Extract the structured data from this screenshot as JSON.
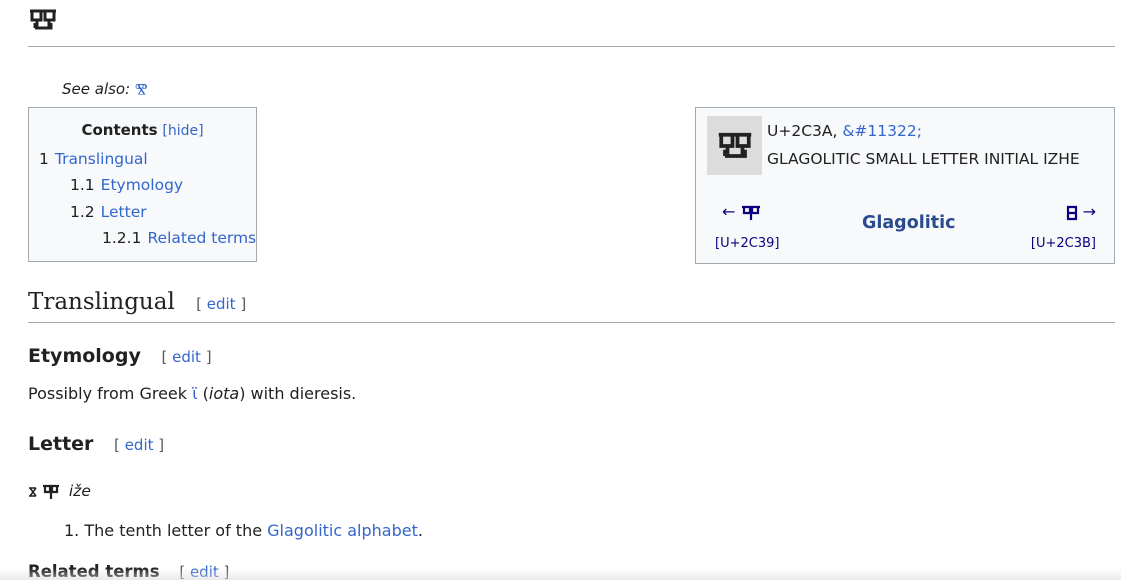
{
  "see_also": {
    "label": "See also:",
    "glyph": "Ⰺ"
  },
  "toc": {
    "title": "Contents",
    "hide_label": "[hide]",
    "items": [
      {
        "num": "1",
        "label": "Translingual"
      },
      {
        "num": "1.1",
        "label": "Etymology"
      },
      {
        "num": "1.2",
        "label": "Letter"
      },
      {
        "num": "1.2.1",
        "label": "Related terms"
      }
    ]
  },
  "infobox": {
    "code_text": "U+2C3A, ",
    "entity": "&#11322;",
    "name": "GLAGOLITIC SMALL LETTER INITIAL IZHE",
    "prev_arrow": "←",
    "prev_code": "[U+2C39]",
    "script": "Glagolitic",
    "next_arrow": "→",
    "next_code": "[U+2C3B]"
  },
  "sections": {
    "translingual": "Translingual",
    "etymology": "Etymology",
    "letter": "Letter",
    "related": "Related terms",
    "edit": "edit",
    "bracket_open": "[",
    "bracket_close": "]"
  },
  "etymology": {
    "prefix": "Possibly from Greek ",
    "greek": "ϊ",
    "open": " (",
    "translit": "iota",
    "suffix": ") with dieresis."
  },
  "letter": {
    "translit": "iže",
    "def_num": "1.",
    "def_prefix": " The tenth letter of the ",
    "def_link": "Glagolitic alphabet",
    "def_suffix": "."
  },
  "colors": {
    "link": "#3366cc",
    "script": "#2a4b8d",
    "rule": "#a2a9b1",
    "box_bg": "#f8f9fa"
  }
}
